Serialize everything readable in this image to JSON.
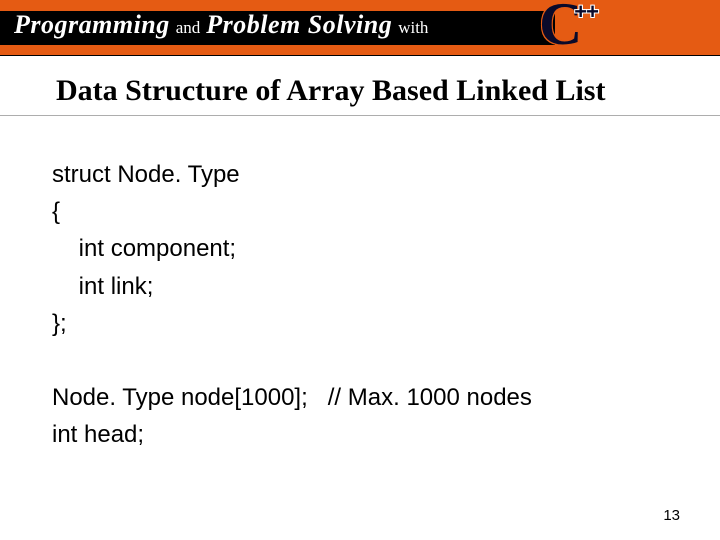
{
  "header": {
    "word1": "Programming",
    "word2": "and",
    "word3": "Problem Solving",
    "word4": "with",
    "logo_c": "C",
    "logo_pp": "++"
  },
  "slide": {
    "title": "Data Structure of Array Based Linked List",
    "code_line1": "struct Node. Type",
    "code_line2": "{",
    "code_line3": "    int component;",
    "code_line4": "    int link;",
    "code_line5": "};",
    "code_line6": "Node. Type node[1000];   // Max. 1000 nodes",
    "code_line7": "int head;",
    "page_number": "13"
  }
}
